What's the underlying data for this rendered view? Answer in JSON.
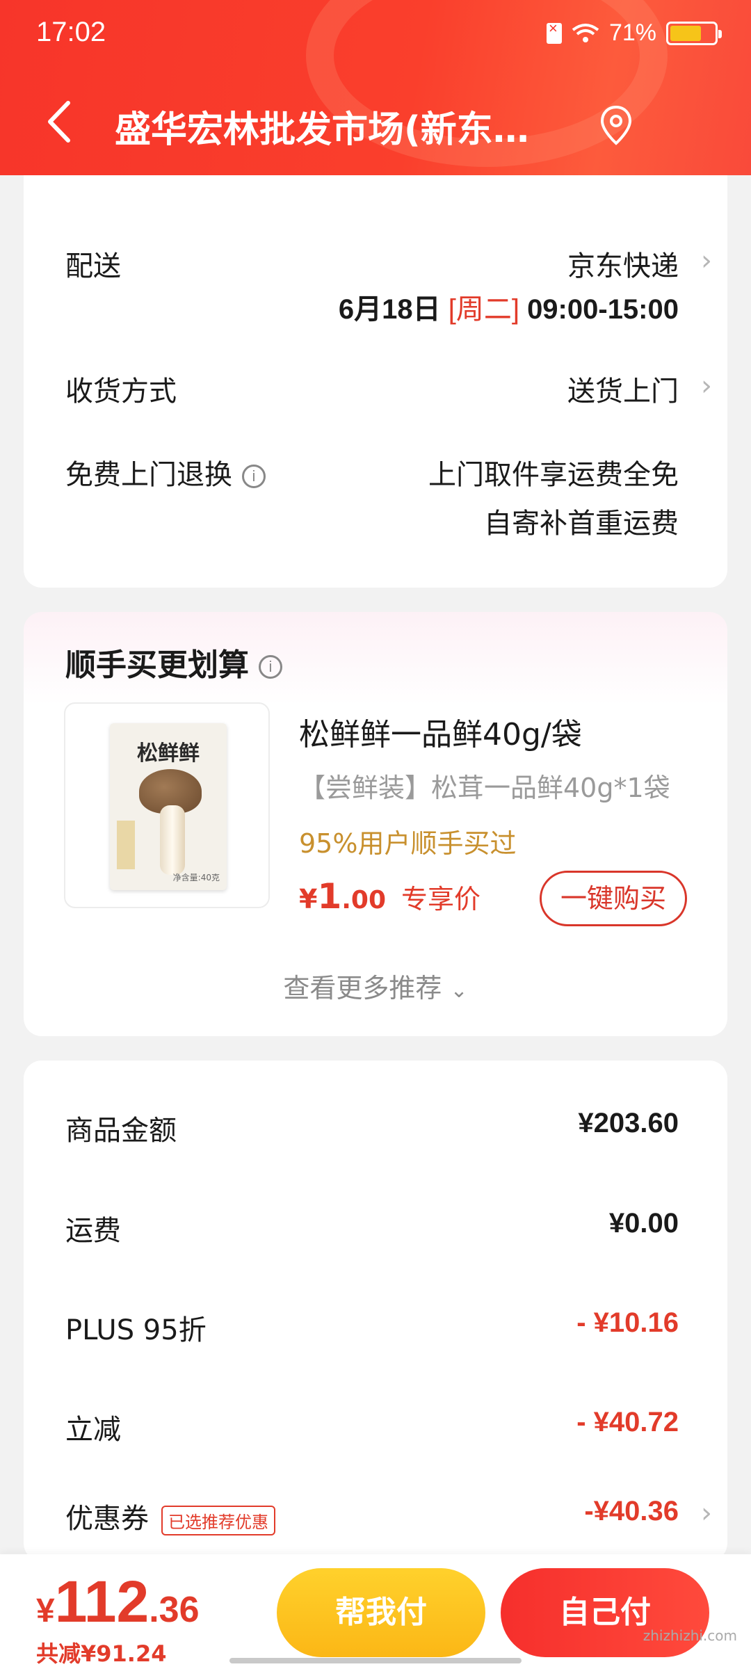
{
  "status_bar": {
    "time": "17:02",
    "battery": "71%"
  },
  "nav": {
    "title": "盛华宏林批发市场(新东…"
  },
  "delivery": {
    "label": "配送",
    "carrier": "京东快递",
    "date": "6月18日",
    "weekday": "[周二]",
    "time_window": "09:00-15:00"
  },
  "receive": {
    "label": "收货方式",
    "value": "送货上门"
  },
  "return": {
    "label": "免费上门退换",
    "line1": "上门取件享运费全免",
    "line2": "自寄补首重运费"
  },
  "addon": {
    "title": "顺手买更划算",
    "product_brand": "松鲜鲜",
    "product_net": "净含量:40克",
    "product_name": "松鲜鲜一品鲜40g/袋",
    "product_sub": "【尝鲜装】松茸一品鲜40g*1袋",
    "bought": "95%用户顺手买过",
    "price_symbol": "¥",
    "price_int": "1",
    "price_dec": ".00",
    "price_tag": "专享价",
    "buy_button": "一键购买",
    "more": "查看更多推荐"
  },
  "summary": {
    "rows": [
      {
        "label": "商品金额",
        "value": "¥203.60"
      },
      {
        "label": "运费",
        "value": "¥0.00"
      },
      {
        "label": "PLUS 95折",
        "value": "- ¥10.16"
      },
      {
        "label": "立减",
        "value": "- ¥40.72"
      },
      {
        "label": "优惠券",
        "value": "-¥40.36",
        "badge": "已选推荐优惠"
      }
    ]
  },
  "bottom": {
    "symbol": "¥",
    "total_int": "112",
    "total_dec": ".36",
    "saved": "共减¥91.24",
    "help_pay": "帮我付",
    "self_pay": "自己付"
  },
  "watermark": "zhizhizhi.com",
  "colors": {
    "accent": "#e23b2a",
    "header": "#f7352a",
    "gold": "#c8902e",
    "help_btn": "#fbb716"
  }
}
